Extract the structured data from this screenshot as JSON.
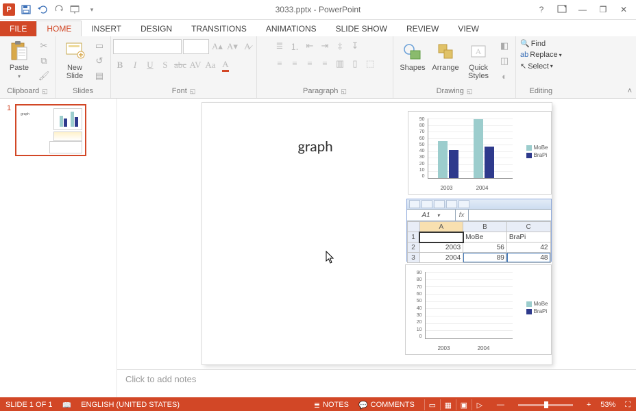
{
  "app": {
    "title": "3033.pptx - PowerPoint"
  },
  "qat": {
    "save": "save",
    "undo": "undo",
    "redo": "redo",
    "start": "start-from-beginning"
  },
  "window": {
    "help": "?",
    "opts": "▭",
    "min": "—",
    "restore": "❐",
    "close": "✕"
  },
  "tabs": {
    "file": "FILE",
    "home": "HOME",
    "insert": "INSERT",
    "design": "DESIGN",
    "transitions": "TRANSITIONS",
    "animations": "ANIMATIONS",
    "slideshow": "SLIDE SHOW",
    "review": "REVIEW",
    "view": "VIEW"
  },
  "ribbon": {
    "clipboard": {
      "label": "Clipboard",
      "paste": "Paste"
    },
    "slides": {
      "label": "Slides",
      "newslide": "New\nSlide"
    },
    "font": {
      "label": "Font"
    },
    "paragraph": {
      "label": "Paragraph"
    },
    "drawing": {
      "label": "Drawing",
      "shapes": "Shapes",
      "arrange": "Arrange",
      "quick": "Quick\nStyles"
    },
    "editing": {
      "label": "Editing",
      "find": "Find",
      "replace": "Replace",
      "select": "Select"
    }
  },
  "thumb": {
    "num": "1"
  },
  "slide": {
    "title": "graph"
  },
  "chart_data": [
    {
      "type": "bar",
      "style": "3d-clustered",
      "categories": [
        "2003",
        "2004"
      ],
      "series": [
        {
          "name": "MoBe",
          "values": [
            56,
            89
          ],
          "color": "#9ccdcd"
        },
        {
          "name": "BraPi",
          "values": [
            42,
            48
          ],
          "color": "#2e3a8c"
        }
      ],
      "ylim": [
        0,
        90
      ],
      "yticks": [
        0,
        10,
        20,
        30,
        40,
        50,
        60,
        70,
        80,
        90
      ]
    },
    {
      "type": "bar",
      "style": "3d-clustered-empty",
      "categories": [
        "2003",
        "2004"
      ],
      "series": [
        {
          "name": "MoBe",
          "values": [
            null,
            null
          ],
          "color": "#9ccdcd"
        },
        {
          "name": "BraPi",
          "values": [
            null,
            null
          ],
          "color": "#2e3a8c"
        }
      ],
      "ylim": [
        0,
        90
      ],
      "yticks": [
        0,
        10,
        20,
        30,
        40,
        50,
        60,
        70,
        80,
        90
      ]
    }
  ],
  "legend": {
    "s1": "MoBe",
    "s2": "BraPi"
  },
  "sheet": {
    "namebox": "A1",
    "cols": [
      "A",
      "B",
      "C"
    ],
    "rows": [
      {
        "n": "1",
        "A": "",
        "B": "MoBe",
        "C": "BraPi"
      },
      {
        "n": "2",
        "A": "2003",
        "B": "56",
        "C": "42"
      },
      {
        "n": "3",
        "A": "2004",
        "B": "89",
        "C": "48"
      }
    ]
  },
  "chart_ticks": {
    "t90": "90",
    "t80": "80",
    "t70": "70",
    "t60": "60",
    "t50": "50",
    "t40": "40",
    "t30": "30",
    "t20": "20",
    "t10": "10",
    "t0": "0"
  },
  "chart_cats": {
    "c1": "2003",
    "c2": "2004"
  },
  "notes": {
    "placeholder": "Click to add notes"
  },
  "status": {
    "slide": "SLIDE 1 OF 1",
    "lang": "ENGLISH (UNITED STATES)",
    "notes": "NOTES",
    "comments": "COMMENTS",
    "zoom": "53%"
  }
}
